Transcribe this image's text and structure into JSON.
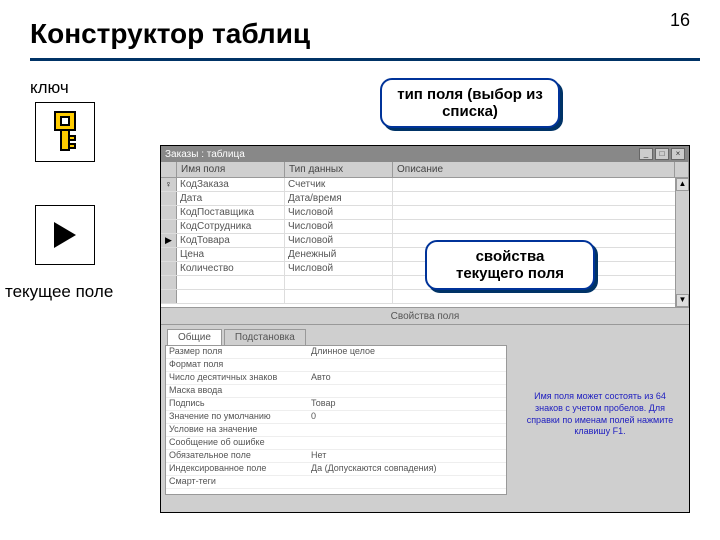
{
  "page_number": "16",
  "title": "Конструктор таблиц",
  "labels": {
    "key": "ключ",
    "current_field": "текущее поле"
  },
  "callouts": {
    "field_type": "тип поля (выбор из списка)",
    "properties": "свойства текущего поля"
  },
  "window": {
    "title": "Заказы : таблица",
    "headers": {
      "name": "Имя поля",
      "type": "Тип данных",
      "desc": "Описание"
    },
    "rows": [
      {
        "sel": "♀",
        "name": "КодЗаказа",
        "type": "Счетчик"
      },
      {
        "sel": "",
        "name": "Дата",
        "type": "Дата/время"
      },
      {
        "sel": "",
        "name": "КодПоставщика",
        "type": "Числовой"
      },
      {
        "sel": "",
        "name": "КодСотрудника",
        "type": "Числовой"
      },
      {
        "sel": "▶",
        "name": "КодТовара",
        "type": "Числовой"
      },
      {
        "sel": "",
        "name": "Цена",
        "type": "Денежный"
      },
      {
        "sel": "",
        "name": "Количество",
        "type": "Числовой"
      },
      {
        "sel": "",
        "name": "",
        "type": ""
      },
      {
        "sel": "",
        "name": "",
        "type": ""
      }
    ],
    "props_label": "Свойства поля",
    "tabs": {
      "general": "Общие",
      "lookup": "Подстановка"
    },
    "props": [
      {
        "l": "Размер поля",
        "v": "Длинное целое"
      },
      {
        "l": "Формат поля",
        "v": ""
      },
      {
        "l": "Число десятичных знаков",
        "v": "Авто"
      },
      {
        "l": "Маска ввода",
        "v": ""
      },
      {
        "l": "Подпись",
        "v": "Товар"
      },
      {
        "l": "Значение по умолчанию",
        "v": "0"
      },
      {
        "l": "Условие на значение",
        "v": ""
      },
      {
        "l": "Сообщение об ошибке",
        "v": ""
      },
      {
        "l": "Обязательное поле",
        "v": "Нет"
      },
      {
        "l": "Индексированное поле",
        "v": "Да (Допускаются совпадения)"
      },
      {
        "l": "Смарт-теги",
        "v": ""
      }
    ],
    "hint": "Имя поля может состоять из 64 знаков с учетом пробелов. Для справки по именам полей нажмите клавишу F1."
  }
}
